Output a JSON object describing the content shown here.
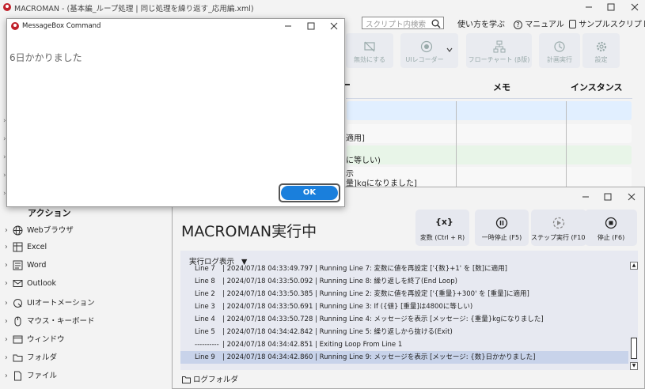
{
  "main_window": {
    "title": "MACROMAN - (基本編_ループ処理 | 同じ処理を繰り返す_応用編.xml)",
    "search_placeholder": "スクリプト内検索",
    "links": {
      "learn": "使い方を学ぶ",
      "manual": "マニュアル",
      "sample": "サンプルスクリプト"
    },
    "ribbon": [
      {
        "label": "無効にする",
        "icon": "disable-icon"
      },
      {
        "label": "UIレコーダー",
        "icon": "recorder-icon"
      },
      {
        "label": "フローチャート (β版)",
        "icon": "flowchart-icon"
      },
      {
        "label": "計画実行",
        "icon": "schedule-icon"
      },
      {
        "label": "設定",
        "icon": "gear-icon"
      }
    ],
    "columns": {
      "memo": "メモ",
      "instance": "インスタンス"
    },
    "rows": [
      "適用]",
      "に等しい)",
      "示",
      "量]kgになりました]"
    ]
  },
  "actions": {
    "header": "アクション",
    "items": [
      "Webブラウザ",
      "Excel",
      "Word",
      "Outlook",
      "UIオートメーション",
      "マウス・キーボード",
      "ウィンドウ",
      "フォルダ",
      "ファイル"
    ]
  },
  "messagebox": {
    "title": "MessageBox Command",
    "message": "6日かかりました",
    "ok_label": "OK"
  },
  "run_window": {
    "heading": "MACROMAN実行中",
    "buttons": [
      {
        "label": "変数 (Ctrl + R)",
        "icon": "variable-icon"
      },
      {
        "label": "一時停止 (F5)",
        "icon": "pause-icon"
      },
      {
        "label": "ステップ実行 (F10)",
        "icon": "step-icon"
      },
      {
        "label": "停止 (F6)",
        "icon": "stop-icon"
      }
    ],
    "log_header": "実行ログ表示",
    "log": [
      {
        "line": "Line 7",
        "text": "| 2024/07/18 04:33:49.797 | Running Line 7: 変数に値を再設定 ['{数}+1' を [数]に適用]"
      },
      {
        "line": "Line 8",
        "text": "| 2024/07/18 04:33:50.092 | Running Line 8: 繰り返しを終了(End Loop)"
      },
      {
        "line": "Line 2",
        "text": "| 2024/07/18 04:33:50.385 | Running Line 2: 変数に値を再設定 ['{重量}+300' を [重量]に適用]"
      },
      {
        "line": "Line 3",
        "text": "| 2024/07/18 04:33:50.691 | Running Line 3: If ({値} [重量]は4800に等しい)"
      },
      {
        "line": "Line 4",
        "text": "| 2024/07/18 04:33:50.728 | Running Line 4: メッセージを表示 [メッセージ: {重量}kgになりました]"
      },
      {
        "line": "Line 5",
        "text": "| 2024/07/18 04:34:42.842 | Running Line 5: 繰り返しから抜ける(Exit)"
      },
      {
        "line": "----------",
        "text": "| 2024/07/18 04:34:42.851 | Exiting Loop From Line 1"
      },
      {
        "line": "Line 9",
        "text": "| 2024/07/18 04:34:42.860 | Running Line 9: メッセージを表示 [メッセージ: {数}日かかりました]"
      }
    ],
    "log_folder": "ログフォルダ"
  },
  "colors": {
    "ok_button": "#1a7fdc",
    "selected_row": "#c8d3ea",
    "highlight_row": "#e1efff",
    "green_row": "#e8f5e8"
  }
}
